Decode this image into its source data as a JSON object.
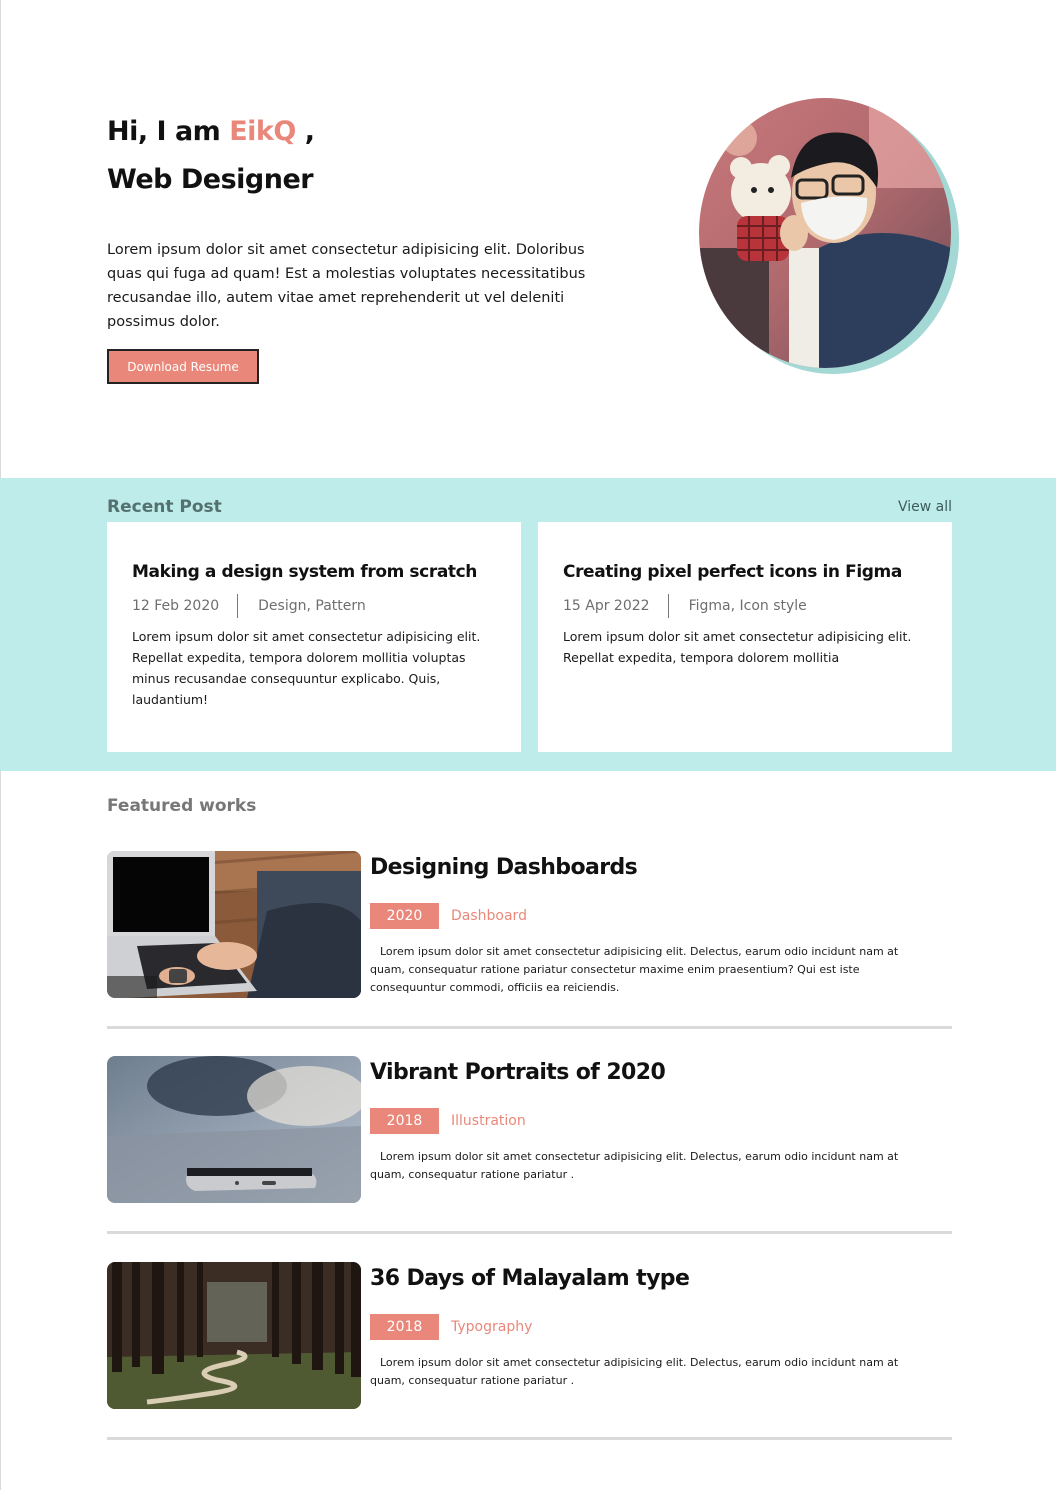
{
  "hero": {
    "greeting": "Hi, I am ",
    "name": "EikQ",
    "name_suffix": " ,",
    "role": "Web Designer",
    "description": "Lorem ipsum dolor sit amet consectetur adipisicing elit. Doloribus quas qui fuga ad quam! Est a molestias voluptates necessitatibus recusandae illo, autem vitae amet reprehenderit ut vel deleniti possimus dolor.",
    "resume_button": "Download Resume"
  },
  "recent_posts": {
    "title": "Recent Post",
    "view_all": "View all",
    "posts": [
      {
        "title": "Making a design system from scratch",
        "date": "12 Feb 2020",
        "tags": "Design, Pattern",
        "body": "Lorem ipsum dolor sit amet consectetur adipisicing elit. Repellat expedita, tempora dolorem mollitia voluptas minus recusandae consequuntur explicabo. Quis, laudantium!"
      },
      {
        "title": "Creating pixel perfect icons in Figma",
        "date": "15 Apr 2022",
        "tags": "Figma, Icon style",
        "body": "Lorem ipsum dolor sit amet consectetur adipisicing elit. Repellat expedita, tempora dolorem mollitia"
      }
    ]
  },
  "featured": {
    "title": "Featured works",
    "works": [
      {
        "title": "Designing Dashboards",
        "year": "2020",
        "category": "Dashboard",
        "body": "Lorem ipsum dolor sit amet consectetur adipisicing elit. Delectus, earum odio incidunt nam at quam, consequatur ratione pariatur consectetur maxime enim praesentium? Qui est iste consequuntur commodi, officiis ea reiciendis.",
        "image": "laptop-typing-photo"
      },
      {
        "title": "Vibrant Portraits of 2020",
        "year": "2018",
        "category": "Illustration",
        "body": "Lorem ipsum dolor sit amet consectetur adipisicing elit. Delectus, earum odio incidunt nam at quam, consequatur ratione pariatur .",
        "image": "smartphone-on-table-photo"
      },
      {
        "title": "36 Days of Malayalam type",
        "year": "2018",
        "category": "Typography",
        "body": "Lorem ipsum dolor sit amet consectetur adipisicing elit. Delectus, earum odio incidunt nam at quam, consequatur ratione pariatur .",
        "image": "forest-path-photo"
      }
    ]
  },
  "colors": {
    "accent": "#e9887a",
    "teal_bg": "#beeceb",
    "avatar_shadow": "#a4d8d5"
  }
}
